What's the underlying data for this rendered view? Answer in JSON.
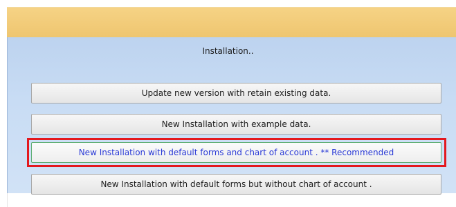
{
  "dialog": {
    "heading": "Installation..",
    "options": [
      {
        "label": "Update new version with retain existing data."
      },
      {
        "label": "New Installation with example data."
      },
      {
        "label": "New Installation with default forms and chart of account . ** Recommended"
      },
      {
        "label": "New Installation with default forms but without chart of account ."
      }
    ]
  },
  "colors": {
    "title_bar": "#eec56f",
    "panel": "#c8dcf4",
    "highlight_border": "#e3181e",
    "recommended_text": "#2a3ad6",
    "recommended_focus_border": "#5fae74"
  }
}
